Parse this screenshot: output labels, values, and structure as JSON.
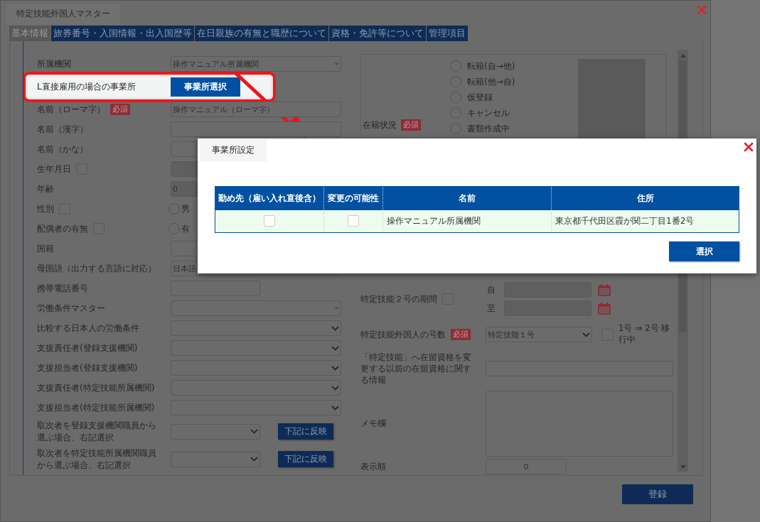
{
  "window": {
    "title": "特定技能外国人マスター"
  },
  "tabs": [
    {
      "label": "基本情報",
      "selected": true
    },
    {
      "label": "旅券番号・入国情報・出入国歴等",
      "selected": false
    },
    {
      "label": "在日親族の有無と職歴について",
      "selected": false
    },
    {
      "label": "資格・免許等について",
      "selected": false
    },
    {
      "label": "管理項目",
      "selected": false
    }
  ],
  "left_fields": [
    {
      "kind": "combo",
      "label": "所属機関",
      "value": "操作マニュアル所属機関"
    },
    {
      "kind": "highlight",
      "label": "L直接雇用の場合の事業所",
      "button": "事業所選択"
    },
    {
      "kind": "input",
      "label": "名前（ローマ字）",
      "required": "必須",
      "value": "操作マニュアル（ローマ字）"
    },
    {
      "kind": "input",
      "label": "名前（漢字）"
    },
    {
      "kind": "input",
      "label": "名前（かな）"
    },
    {
      "kind": "disabled",
      "label": "生年月日",
      "checked": false
    },
    {
      "kind": "disabled",
      "label": "年齢",
      "value": "0"
    },
    {
      "kind": "radio",
      "label": "性別",
      "checked": false,
      "options": [
        {
          "label": "男",
          "selected": false
        }
      ]
    },
    {
      "kind": "radio",
      "label": "配偶者の有無",
      "checked": false,
      "options": [
        {
          "label": "有",
          "selected": false
        }
      ]
    },
    {
      "kind": "input",
      "label": "国籍"
    },
    {
      "kind": "input",
      "label": "母国語（出力する言語に対応）",
      "value": "日本語"
    },
    {
      "kind": "short",
      "label": "携帯電話番号"
    },
    {
      "kind": "combo",
      "label": "労働条件マスター"
    },
    {
      "kind": "select",
      "label": "比較する日本人の労働条件"
    },
    {
      "kind": "select",
      "label": "支援責任者(登録支援機関)"
    },
    {
      "kind": "select",
      "label": "支援担当者(登録支援機関)"
    },
    {
      "kind": "select",
      "label": "支援責任者(特定技能所属機関)"
    },
    {
      "kind": "select",
      "label": "支援担当者(特定技能所属機関)"
    },
    {
      "kind": "select_button",
      "label": "取次者を登録支援機関職員から選ぶ場合、右記選択",
      "button": "下記に反映"
    },
    {
      "kind": "select_button",
      "label": "取次者を特定技能所属機関職員から選ぶ場合、右記選択",
      "button": "下記に反映"
    }
  ],
  "right": {
    "status": {
      "label": "在籍状況",
      "required": "必須",
      "options": [
        {
          "label": "転籍(自→他)",
          "selected": false
        },
        {
          "label": "転籍(他→自)",
          "selected": false
        },
        {
          "label": "仮登録",
          "selected": false
        },
        {
          "label": "キャンセル",
          "selected": false
        },
        {
          "label": "書類作成中",
          "selected": false
        }
      ]
    },
    "period": {
      "label": "特定技能２号の期間",
      "checked": false,
      "rows": [
        {
          "label": "自"
        },
        {
          "label": "至"
        }
      ]
    },
    "grade": {
      "label": "特定技能外国人の号数",
      "required": "必須",
      "value": "特定技能１号",
      "transition": {
        "label": "1号 ⇒ 2号 移行中",
        "checked": false
      }
    },
    "previous_status": {
      "label": "「特定技能」へ在留資格を変更する以前の在留資格に関する情報"
    },
    "memo": {
      "label": "メモ欄"
    },
    "order": {
      "label": "表示順",
      "value": "0"
    }
  },
  "register_button": "登録",
  "dialog": {
    "title": "事業所設定",
    "columns": [
      "勤め先（雇い入れ直後含）",
      "変更の可能性",
      "名前",
      "住所"
    ],
    "rows": [
      {
        "workplace_checked": false,
        "changeable_checked": false,
        "name": "操作マニュアル所属機関",
        "address": "東京都千代田区霞が関二丁目1番2号"
      }
    ],
    "button": "選択"
  }
}
